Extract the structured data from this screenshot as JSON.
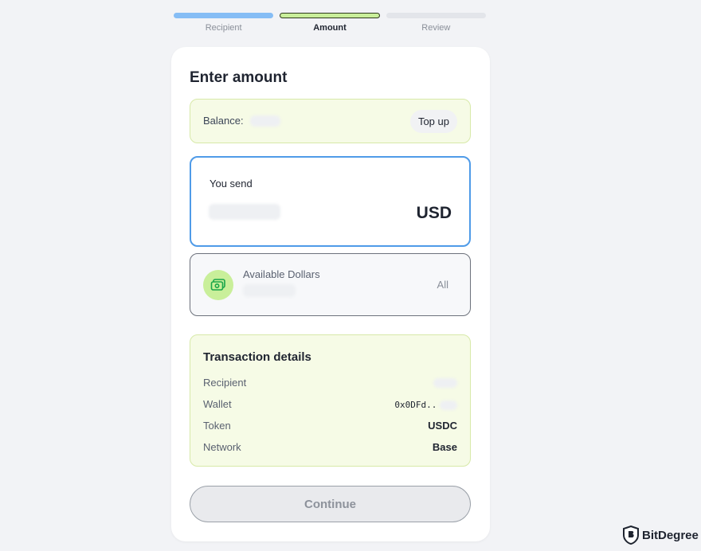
{
  "stepper": {
    "steps": [
      {
        "label": "Recipient",
        "state": "done"
      },
      {
        "label": "Amount",
        "state": "active"
      },
      {
        "label": "Review",
        "state": "pending"
      }
    ]
  },
  "card": {
    "title": "Enter amount",
    "balance": {
      "label": "Balance:",
      "topup_label": "Top up"
    },
    "send": {
      "label": "You send",
      "currency": "USD"
    },
    "available": {
      "title": "Available Dollars",
      "all_label": "All",
      "icon": "cash-icon"
    },
    "details": {
      "title": "Transaction details",
      "rows": [
        {
          "label": "Recipient",
          "value": ""
        },
        {
          "label": "Wallet",
          "value": "0x0DFd.."
        },
        {
          "label": "Token",
          "value": "USDC"
        },
        {
          "label": "Network",
          "value": "Base"
        }
      ]
    },
    "continue_label": "Continue"
  },
  "watermark": {
    "text": "BitDegree"
  },
  "colors": {
    "accent_blue": "#4f9be8",
    "accent_green": "#c9ef9a",
    "panel_green": "#f6fbe6"
  }
}
